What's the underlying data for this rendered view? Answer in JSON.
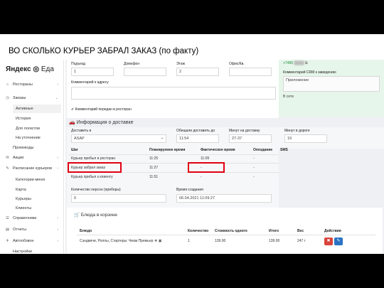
{
  "slide_title": "ВО СКОЛЬКО КУРЬЕР ЗАБРАЛ ЗАКАЗ (по факту)",
  "logo": {
    "ya": "Яндекс",
    "eda": "Еда"
  },
  "sidebar": {
    "items": [
      {
        "icon": "⌂",
        "label": "Рестораны",
        "chevron": "‹"
      },
      {
        "icon": "◷",
        "label": "Заказы",
        "chevron": "⌄"
      }
    ],
    "sub_orders": [
      "Активные",
      "История",
      "Для логистов",
      "На уточнение"
    ],
    "items2": [
      {
        "icon": "",
        "label": "Промокоды",
        "chevron": ""
      },
      {
        "icon": "✉",
        "label": "Акции",
        "chevron": "‹"
      },
      {
        "icon": "✎",
        "label": "Расписание курьеров",
        "chevron": "‹"
      }
    ],
    "sub_couriers": [
      "Категории меню",
      "Карта",
      "Курьеры",
      "Клиенты"
    ],
    "items3": [
      {
        "icon": "☰",
        "label": "Справочники",
        "chevron": "‹"
      },
      {
        "icon": "▤",
        "label": "Отчеты",
        "chevron": "‹"
      },
      {
        "icon": "✈",
        "label": "Автообзвон",
        "chevron": "‹"
      },
      {
        "icon": "",
        "label": "Настройки",
        "chevron": ""
      }
    ]
  },
  "address": {
    "entrance_label": "Подъезд",
    "entrance_value": "1",
    "intercom_label": "Домофон",
    "intercom_value": "",
    "floor_label": "Этаж",
    "floor_value": "2",
    "office_label": "Офис/Кв.",
    "office_value": "",
    "comment_label": "Комментарий к адресу",
    "comment_sent": "Комментарий передан в ресторан"
  },
  "crm": {
    "phone": "+7495",
    "comment_label": "Комментарий CRM к заведению",
    "app_value": "Приложение",
    "status": "В сети"
  },
  "delivery": {
    "title": "Информация о доставке",
    "deliver_in_label": "Доставить в",
    "deliver_in_value": "ASAP",
    "promised_label": "Обещали доставить до",
    "promised_value": "11:54",
    "to_delivery_label": "Минут на доставку",
    "to_delivery_value": "27-37",
    "on_road_label": "Минут в дороге",
    "on_road_value": "19",
    "headers": [
      "Шаг",
      "Планируемое время",
      "Фактическое время",
      "Опоздание",
      "SMS"
    ],
    "rows": [
      [
        "Курьер прибыл в ресторан",
        "11:25",
        "11:09",
        "-"
      ],
      [
        "Курьер забрал заказ",
        "11:27",
        "-",
        "-"
      ],
      [
        "Курьер прибыл к клиенту",
        "11:51",
        "-",
        "-"
      ]
    ],
    "persons_label": "Количество персон (приборы)",
    "persons_value": "0",
    "created_label": "Время создания",
    "created_value": "06.04.2021 11:09:27"
  },
  "dishes": {
    "title": "Блюда в корзине",
    "headers": [
      "Блюдо",
      "Количество",
      "Стоимость одного",
      "Итого",
      "Вес",
      "Действия"
    ],
    "rows": [
      [
        "Сэндвичи, Роллы, Стартеры: Чиам Премьер",
        "1",
        "139.00",
        "139.00",
        "247 г"
      ]
    ]
  }
}
